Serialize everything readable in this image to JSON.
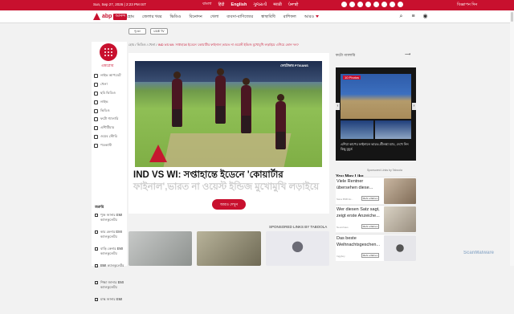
{
  "topbar": {
    "date": "Sun, Sep 27, 2026 | 2:23 PM IST",
    "languages": [
      "বাংলা",
      "हिंदी",
      "English",
      "ગુજરાતી",
      "मराठी",
      "ਪੰਜਾਬੀ"
    ],
    "active_language": "English",
    "brand_right": "বিজ্ঞাপন দিন"
  },
  "navbar": {
    "logo_brand": "abp",
    "logo_tag": "আনন্দ",
    "items": [
      "হোম",
      "জেলার খবর",
      "ভিডিও",
      "বিনোদন",
      "খেলা",
      "ব্যবসা-বাণিজ্যের",
      "স্বাস্থ্যবিধি",
      "রাশিফল",
      "আরও"
    ]
  },
  "badges": [
    "পুজো",
    "LIVE TV"
  ],
  "sidebar": {
    "menu_label": "এক্সপ্লোর",
    "items": [
      "লাইভ আপডেট",
      "খেলা",
      "ছবি ভিডিও",
      "লাইভ",
      "ভিডিও",
      "ফটো গ্যালারি",
      "এন্টিটিয়ার",
      "ওয়েব স্টোরি",
      "পডকাস্ট"
    ],
    "section_head": "জরুরি",
    "items2": [
      "পুজ় জানার EMI ক্যালকুলেটর",
      "কার কেনার EMI ক্যালকুলেটর",
      "বাড়ি কেনার EMI ক্যালকুলেটর",
      "BMI ক্যালকুলেটর",
      "শিক্ষা জানার EMI ক্যালকুলেটর",
      "মাস্ক জানার EMI"
    ]
  },
  "breadcrumb": {
    "trail": "হোম / ভিডিও / খেলা /",
    "current": "IND VS WI: সপ্তাহান্তে ইডেনে 'কোয়ার্টার ফাইনাল',ভারত না ওয়েস্ট ইন্ডিজ মুখোমুখি লড়াইয়ে এগিয়ে কোন দল?"
  },
  "article": {
    "watermark": "ফোটোকার PTI/IANS",
    "headline": "IND VS WI: সপ্তাহান্তে ইডেনে 'কোয়ার্টার",
    "headline_faded": "ফাইনাল',ভারত না ওয়েস্ট ইন্ডিজ মুখোমুখি লড়াইয়ে",
    "more_button": "আরও দেখুন"
  },
  "right": {
    "label": "ফটো গ্যালারি",
    "photo_tag": "10 Photos",
    "caption": "এশিয়া কাপের ফাইনালে ভারত-শ্রীলঙ্কা ম্যাচ, দেখে নিন কিছু মুহূর্ত",
    "you_may_like": "You May Like",
    "sponsored_by": "Sponsored Links by Taboola",
    "ads": [
      {
        "text": "Viele Rentner übersehen diese...",
        "source": "Sana BNB Ex...",
        "button": "Mehr erfahren"
      },
      {
        "text": "Wer diesen Satz sagt, zeigt erste Anzeiche...",
        "source": "Neurohaus",
        "button": "Mehr erfahren"
      },
      {
        "text": "Das beste Weihnachtsgeschen...",
        "source": "Inggboy",
        "button": "Mehr erfahren"
      }
    ]
  },
  "sponsored_strip": "SPONSORED LINKS BY TABOOLA",
  "watermark_logo": "ScanMalware",
  "colors": {
    "brand_red": "#c8102e"
  }
}
